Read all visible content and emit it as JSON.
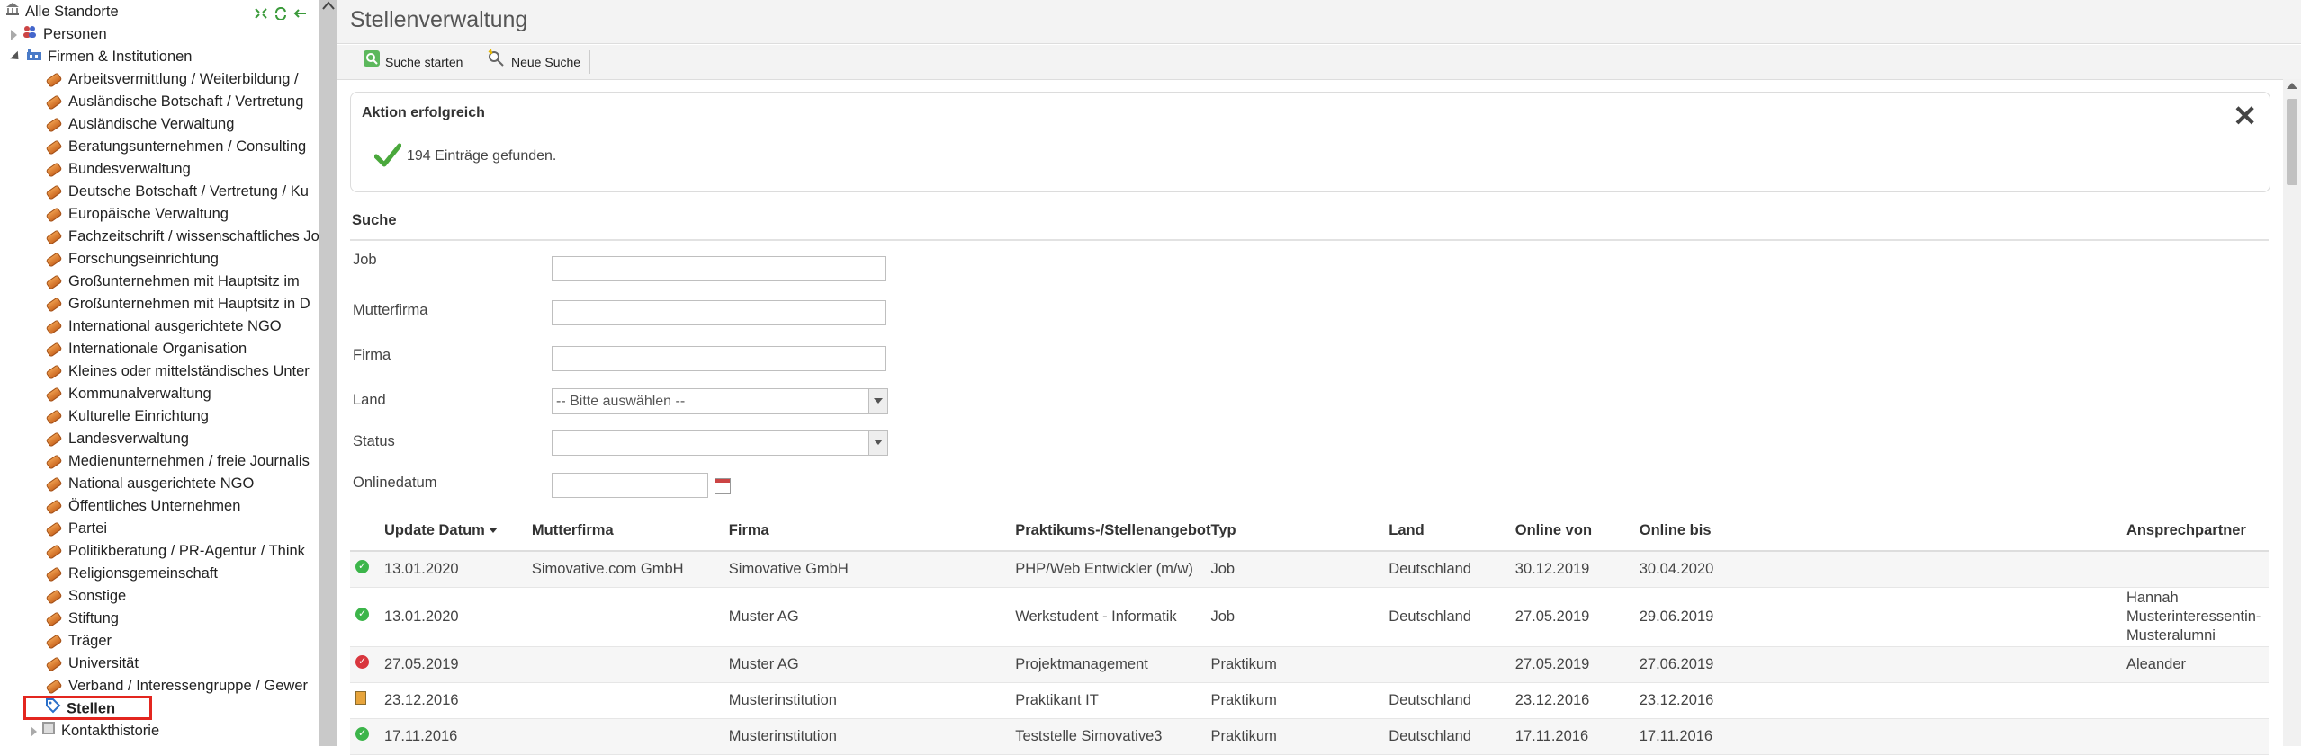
{
  "tree": {
    "root_label": "Alle Standorte",
    "personen_label": "Personen",
    "firmen_label": "Firmen & Institutionen",
    "categories": [
      "Arbeitsvermittlung / Weiterbildung /",
      "Ausländische Botschaft / Vertretung",
      "Ausländische Verwaltung",
      "Beratungsunternehmen / Consulting",
      "Bundesverwaltung",
      "Deutsche Botschaft / Vertretung / Ku",
      "Europäische Verwaltung",
      "Fachzeitschrift / wissenschaftliches Jo",
      "Forschungseinrichtung",
      "Großunternehmen mit Hauptsitz im",
      "Großunternehmen mit Hauptsitz in D",
      "International ausgerichtete NGO",
      "Internationale Organisation",
      "Kleines oder mittelständisches Unter",
      "Kommunalverwaltung",
      "Kulturelle Einrichtung",
      "Landesverwaltung",
      "Medienunternehmen / freie Journalis",
      "National ausgerichtete NGO",
      "Öffentliches Unternehmen",
      "Partei",
      "Politikberatung / PR-Agentur / Think",
      "Religionsgemeinschaft",
      "Sonstige",
      "Stiftung",
      "Träger",
      "Universität",
      "Verband / Interessengruppe / Gewer"
    ],
    "stellen_label": "Stellen",
    "kontakt_label": "Kontakthistorie"
  },
  "header": {
    "title": "Stellenverwaltung"
  },
  "toolbar": {
    "search_label": "Suche starten",
    "new_search_label": "Neue Suche"
  },
  "message": {
    "title": "Aktion erfolgreich",
    "text": "194 Einträge gefunden."
  },
  "search": {
    "heading": "Suche",
    "job_label": "Job",
    "mutterfirma_label": "Mutterfirma",
    "firma_label": "Firma",
    "land_label": "Land",
    "land_value": "-- Bitte auswählen --",
    "status_label": "Status",
    "status_value": "",
    "onlinedatum_label": "Onlinedatum"
  },
  "table": {
    "headers": [
      "Update Datum",
      "Mutterfirma",
      "Firma",
      "Praktikums-/Stellenangebot",
      "Typ",
      "Land",
      "Online von",
      "Online bis",
      "Ansprechpartner"
    ],
    "rows": [
      {
        "status": "ok",
        "update": "13.01.2020",
        "mutter": "Simovative.com GmbH",
        "firma": "Simovative GmbH",
        "angebot": "PHP/Web Entwickler (m/w)",
        "typ": "Job",
        "land": "Deutschland",
        "von": "30.12.2019",
        "bis": "30.04.2020",
        "kontakt": ""
      },
      {
        "status": "ok",
        "update": "13.01.2020",
        "mutter": "",
        "firma": "Muster AG",
        "angebot": "Werkstudent - Informatik",
        "typ": "Job",
        "land": "Deutschland",
        "von": "27.05.2019",
        "bis": "29.06.2019",
        "kontakt": "Hannah Musterinteressentin-Musteralumni"
      },
      {
        "status": "bad",
        "update": "27.05.2019",
        "mutter": "",
        "firma": "Muster AG",
        "angebot": "Projektmanagement",
        "typ": "Praktikum",
        "land": "",
        "von": "27.05.2019",
        "bis": "27.06.2019",
        "kontakt": "Aleander"
      },
      {
        "status": "doc",
        "update": "23.12.2016",
        "mutter": "",
        "firma": "Musterinstitution",
        "angebot": "Praktikant IT",
        "typ": "Praktikum",
        "land": "Deutschland",
        "von": "23.12.2016",
        "bis": "23.12.2016",
        "kontakt": ""
      },
      {
        "status": "ok",
        "update": "17.11.2016",
        "mutter": "",
        "firma": "Musterinstitution",
        "angebot": "Teststelle Simovative3",
        "typ": "Praktikum",
        "land": "Deutschland",
        "von": "17.11.2016",
        "bis": "17.11.2016",
        "kontakt": ""
      }
    ]
  }
}
